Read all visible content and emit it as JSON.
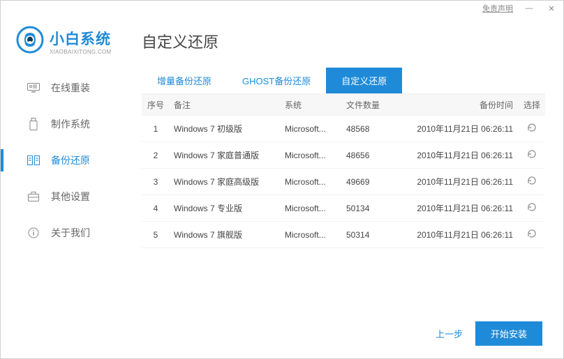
{
  "titlebar": {
    "disclaimer": "免责声明"
  },
  "brand": {
    "title": "小白系统",
    "subtitle": "XIAOBAIXITONG.COM"
  },
  "sidebar": {
    "items": [
      {
        "label": "在线重装"
      },
      {
        "label": "制作系统"
      },
      {
        "label": "备份还原"
      },
      {
        "label": "其他设置"
      },
      {
        "label": "关于我们"
      }
    ]
  },
  "main": {
    "title": "自定义还原",
    "tabs": [
      {
        "label": "增量备份还原"
      },
      {
        "label": "GHOST备份还原"
      },
      {
        "label": "自定义还原"
      }
    ],
    "columns": {
      "idx": "序号",
      "note": "备注",
      "sys": "系统",
      "cnt": "文件数量",
      "time": "备份时间",
      "sel": "选择"
    },
    "rows": [
      {
        "idx": "1",
        "note": "Windows 7 初级版",
        "sys": "Microsoft...",
        "cnt": "48568",
        "time": "2010年11月21日 06:26:11"
      },
      {
        "idx": "2",
        "note": "Windows 7 家庭普通版",
        "sys": "Microsoft...",
        "cnt": "48656",
        "time": "2010年11月21日 06:26:11"
      },
      {
        "idx": "3",
        "note": "Windows 7 家庭高级版",
        "sys": "Microsoft...",
        "cnt": "49669",
        "time": "2010年11月21日 06:26:11"
      },
      {
        "idx": "4",
        "note": "Windows 7 专业版",
        "sys": "Microsoft...",
        "cnt": "50134",
        "time": "2010年11月21日 06:26:11"
      },
      {
        "idx": "5",
        "note": "Windows 7 旗舰版",
        "sys": "Microsoft...",
        "cnt": "50314",
        "time": "2010年11月21日 06:26:11"
      }
    ]
  },
  "footer": {
    "prev": "上一步",
    "start": "开始安装"
  }
}
